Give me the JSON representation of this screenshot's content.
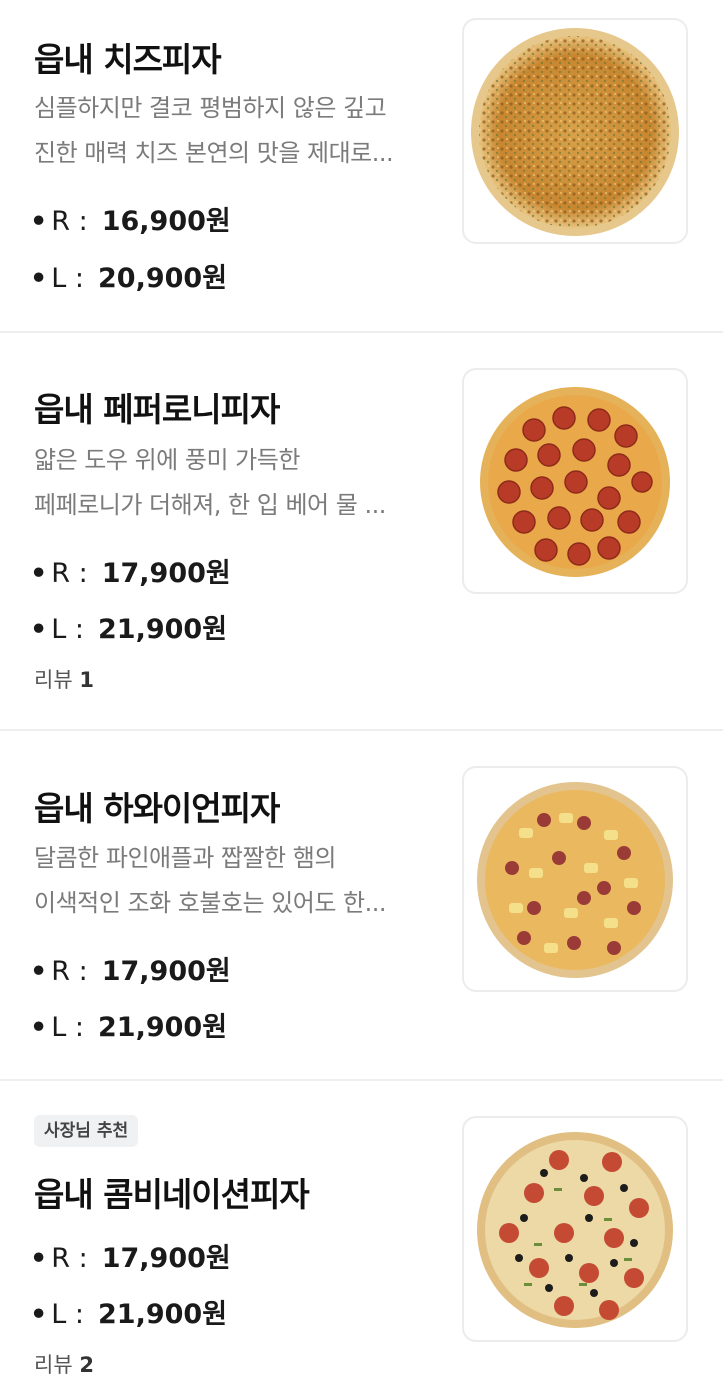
{
  "menu": {
    "items": [
      {
        "title": "읍내 치즈피자",
        "desc_lines": [
          "심플하지만 결코 평범하지 않은 깊고",
          "진한 매력 치즈 본연의 맛을 제대로..."
        ],
        "prices": [
          {
            "bullet": "•",
            "size": "R :",
            "price": "16,900원"
          },
          {
            "bullet": "•",
            "size": "L :",
            "price": "20,900원"
          }
        ],
        "image": "cheese-pizza-photo"
      },
      {
        "title": "읍내 페퍼로니피자",
        "desc_lines": [
          "얇은 도우 위에 풍미 가득한",
          "페페로니가 더해져, 한 입 베어 물 ..."
        ],
        "prices": [
          {
            "bullet": "•",
            "size": "R :",
            "price": "17,900원"
          },
          {
            "bullet": "•",
            "size": "L :",
            "price": "21,900원"
          }
        ],
        "review_label": "리뷰",
        "review_count": "1",
        "image": "pepperoni-pizza-photo"
      },
      {
        "title": "읍내 하와이언피자",
        "desc_lines": [
          "달콤한 파인애플과 짭짤한 햄의",
          "이색적인 조화 호불호는 있어도  한..."
        ],
        "prices": [
          {
            "bullet": "•",
            "size": "R :",
            "price": "17,900원"
          },
          {
            "bullet": "•",
            "size": "L :",
            "price": "21,900원"
          }
        ],
        "image": "hawaiian-pizza-photo"
      },
      {
        "badge": "사장님 추천",
        "title": "읍내 콤비네이션피자",
        "prices": [
          {
            "bullet": "•",
            "size": "R :",
            "price": "17,900원"
          },
          {
            "bullet": "•",
            "size": "L :",
            "price": "21,900원"
          }
        ],
        "review_label": "리뷰",
        "review_count": "2",
        "image": "combination-pizza-photo"
      }
    ]
  },
  "colors": {
    "title": "#111111",
    "description": "#7b7b7b",
    "divider": "#eeeeee",
    "badge_bg": "#f0f1f3"
  }
}
